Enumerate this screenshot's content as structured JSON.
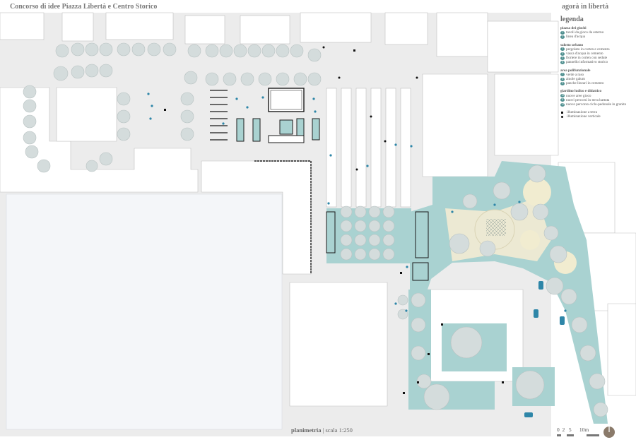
{
  "header": {
    "title": "Concorso di idee Piazza Libertà e Centro Storico",
    "brand": "agorà in libertà"
  },
  "legend": {
    "heading": "legenda",
    "groups": [
      {
        "title": "piazza dei giochi",
        "items": [
          {
            "marker": "1",
            "label": "tavoli da gioco da esterno"
          },
          {
            "marker": "2",
            "label": "linea d'acqua"
          }
        ]
      },
      {
        "title": "salotto urbano",
        "items": [
          {
            "marker": "3",
            "label": "pergolato in corten e cemento"
          },
          {
            "marker": "4",
            "label": "vasca d'acqua in cemento"
          },
          {
            "marker": "5",
            "label": "fioriere in corten con sedute"
          },
          {
            "marker": "6",
            "label": "pannello informativo storico"
          }
        ]
      },
      {
        "title": "area polifunzionale",
        "items": [
          {
            "marker": "7",
            "label": "verde a raso"
          },
          {
            "marker": "8",
            "label": "aiuole galum"
          },
          {
            "marker": "9",
            "label": "panche lineari in cemento"
          }
        ]
      },
      {
        "title": "giardino ludico e didattico",
        "items": [
          {
            "marker": "10",
            "label": "nuove aree gioco"
          },
          {
            "marker": "11",
            "label": "nuovi percorsi in terra battuta"
          },
          {
            "marker": "12",
            "label": "nuovo percorso ciclo-pedonale in granito"
          }
        ]
      },
      {
        "title": "",
        "items": [
          {
            "marker": "square",
            "label": "illuminazione a terra"
          },
          {
            "marker": "dot",
            "label": "illuminazione verticale"
          }
        ]
      }
    ]
  },
  "caption": {
    "name": "planimetria",
    "scale": "scala 1:250"
  },
  "scalebar": {
    "ticks": "0  2   5      10m"
  },
  "colors": {
    "teal": "#a9d2d1",
    "teal_dark": "#4f8f8f",
    "street": "#ececec",
    "block": "#ffffff",
    "tree": "#cfd7d7",
    "path": "#f1ecd0",
    "accent": "#2e86a8"
  },
  "icons": [
    "north-arrow-icon",
    "tree-icon",
    "car-icon",
    "lamp-icon"
  ]
}
